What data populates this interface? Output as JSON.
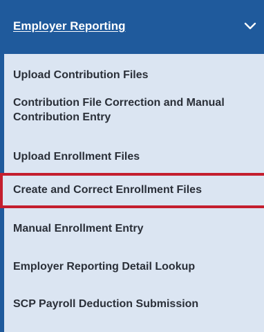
{
  "menu": {
    "title": "Employer Reporting",
    "items": [
      {
        "label": "Upload Contribution Files"
      },
      {
        "label": "Contribution File Correction and Manual Contribution Entry"
      },
      {
        "label": "Upload Enrollment Files"
      },
      {
        "label": "Create and Correct Enrollment Files",
        "selected": true
      },
      {
        "label": "Manual Enrollment Entry"
      },
      {
        "label": "Employer Reporting Detail Lookup"
      },
      {
        "label": "SCP Payroll Deduction Submission"
      }
    ]
  },
  "colors": {
    "header_bg": "#1f5a9c",
    "menu_bg": "#dbe5f2",
    "selection_border": "#c41e2e"
  },
  "icons": {
    "header_toggle": "chevron-down-icon"
  }
}
